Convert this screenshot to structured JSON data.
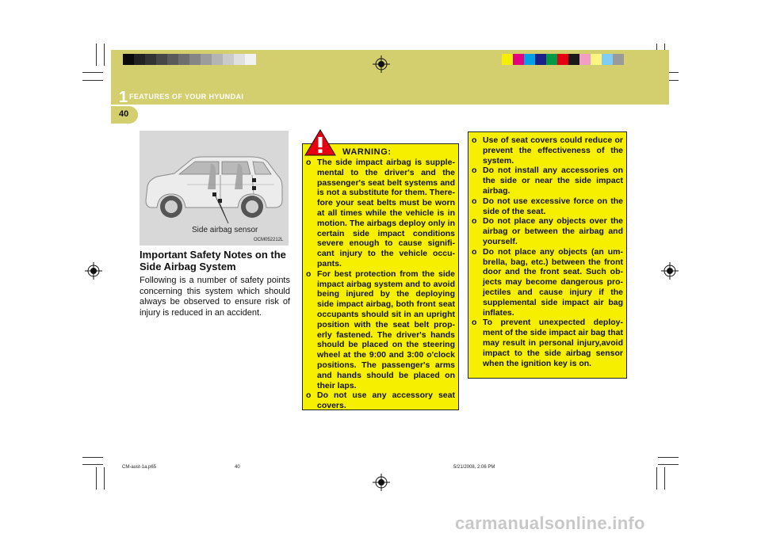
{
  "header": {
    "section_number": "1",
    "section_title": "FEATURES OF YOUR HYUNDAI",
    "page_number": "40",
    "grayscale_swatches": [
      "#0a0a0a",
      "#222222",
      "#333333",
      "#474747",
      "#5a5a5a",
      "#6e6e6e",
      "#858585",
      "#9c9c9c",
      "#b4b4b4",
      "#cacaca",
      "#e0e0e0",
      "#f2f2f2"
    ],
    "color_swatches": [
      "#f6ef00",
      "#e4007f",
      "#00a0e9",
      "#1d2088",
      "#009944",
      "#e60012",
      "#1a1a1a",
      "#f19ec2",
      "#fff57f",
      "#7fcdf4",
      "#9a9a9a"
    ],
    "band_color": "#d4cf6e"
  },
  "figure": {
    "label": "Side airbag sensor",
    "code": "OCM052212L"
  },
  "left_column": {
    "heading": "Important Safety Notes on the Side Airbag System",
    "intro": "Following is a number of safety points concerning this system which should always be observed to ensure risk of injury is reduced in an accident."
  },
  "warning": {
    "icon": "exclamation-triangle-icon",
    "title": "WARNING:",
    "bullet": "o",
    "items": [
      "The side impact airbag is supple-mental to the driver's and the passenger's seat belt systems and is not a substitute for them. There-fore your seat belts must be worn at all times while the vehicle is in motion. The airbags deploy only in certain side impact conditions severe enough to cause signifi-cant injury to the vehicle occu-pants.",
      "For best protection from the side impact airbag system and to avoid being injured by the deploying side impact airbag, both front seat occupants should sit in an upright position with the seat belt prop-erly fastened. The driver's hands should be placed on the steering wheel at the 9:00 and 3:00 o'clock positions. The passenger's arms and hands should be placed on their laps.",
      "Do not use any accessory seat covers."
    ],
    "box_color": "#f6ef00"
  },
  "right_column": {
    "bullet": "o",
    "items": [
      "Use of seat covers could reduce or prevent the effectiveness of the system.",
      "Do not install any accessories on the side or near the side impact airbag.",
      "Do not use excessive force on the side of the seat.",
      "Do not place any objects over the airbag or between the airbag and yourself.",
      "Do not place any objects (an um-brella, bag, etc.) between the front door and the front seat. Such ob-jects may become dangerous pro-jectiles and cause injury if the supplemental side impact air bag inflates.",
      "To prevent unexpected deploy-ment of the side impact air bag that may result in personal injury,avoid impact to the side airbag sensor when the ignition key is on."
    ]
  },
  "footer": {
    "file_name": "CM-aust-1a.p65",
    "page": "40",
    "timestamp": "5/21/2008, 2:06 PM"
  },
  "watermark": "carmanualsonline.info"
}
